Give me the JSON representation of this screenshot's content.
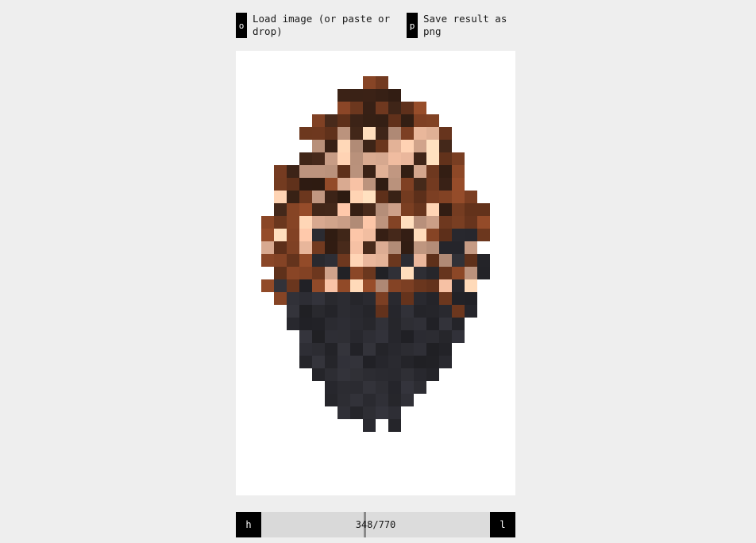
{
  "toolbar": {
    "load": {
      "key": "o",
      "label": "Load image (or paste or drop)"
    },
    "save": {
      "key": "p",
      "label": "Save result as png"
    }
  },
  "canvas": {
    "description_icon": "mosaic-portrait-image"
  },
  "slider": {
    "prev_key": "h",
    "next_key": "l",
    "current": 348,
    "total": 770,
    "readout": "348/770"
  },
  "colors": {
    "background": "#eeeeee",
    "key_bg": "#000000",
    "canvas_bg": "#ffffff"
  }
}
